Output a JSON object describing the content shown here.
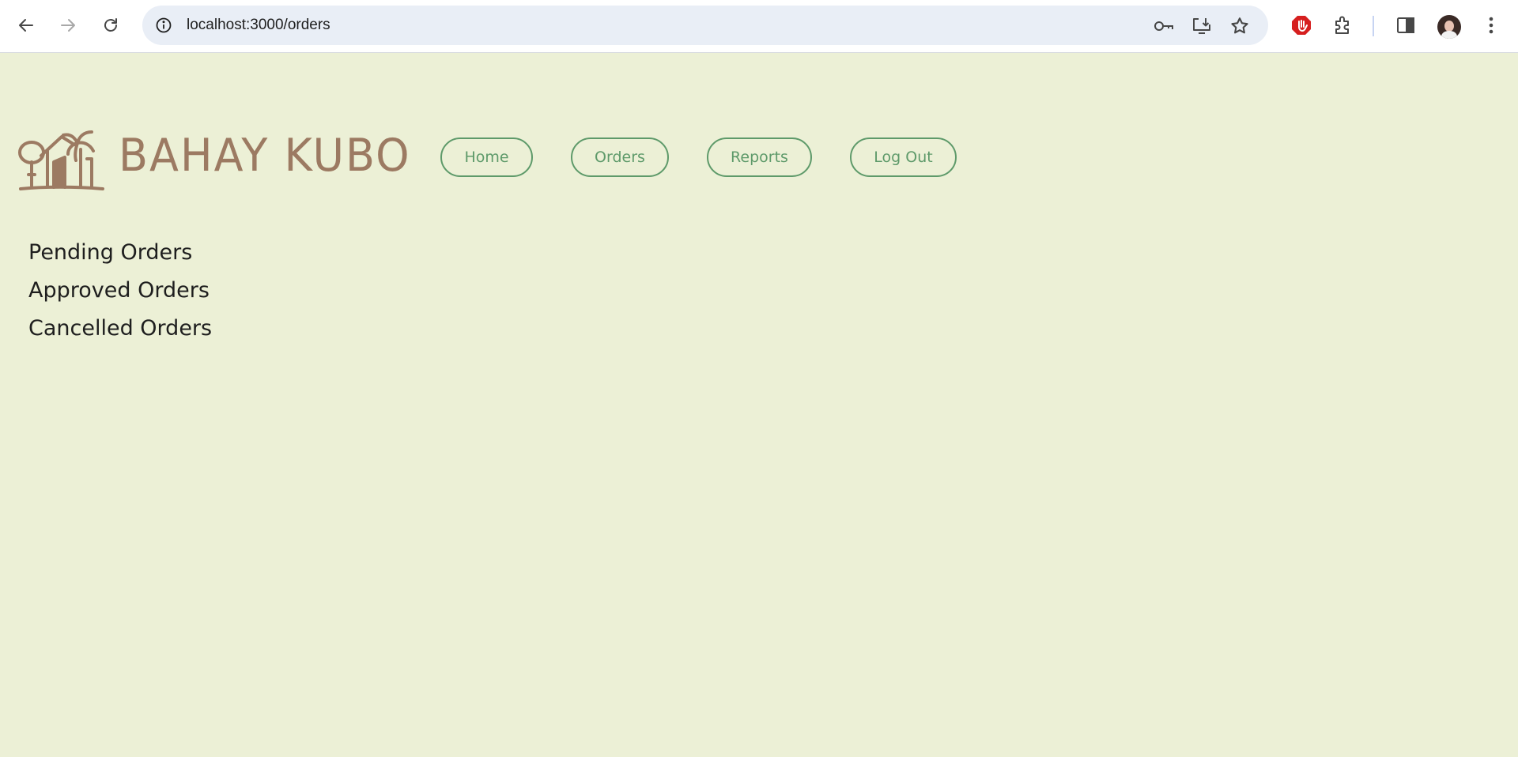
{
  "browser": {
    "url": "localhost:3000/orders",
    "icons": {
      "back": "back-arrow-icon",
      "forward": "forward-arrow-icon",
      "reload": "reload-icon",
      "site_info": "info-icon",
      "password": "key-icon",
      "install": "install-app-icon",
      "bookmark": "star-icon",
      "extension_block": "stop-hand-icon",
      "extensions": "puzzle-icon",
      "side_panel": "side-panel-icon",
      "menu": "more-vert-icon"
    }
  },
  "site": {
    "brand": "BAHAY KUBO",
    "colors": {
      "background": "#ecf0d6",
      "brand": "#9c7a62",
      "accent": "#5e9a6a",
      "text": "#1e1e1e"
    },
    "nav": {
      "home": "Home",
      "orders": "Orders",
      "reports": "Reports",
      "logout": "Log Out"
    }
  },
  "orders": {
    "pending": "Pending Orders",
    "approved": "Approved Orders",
    "cancelled": "Cancelled Orders"
  }
}
